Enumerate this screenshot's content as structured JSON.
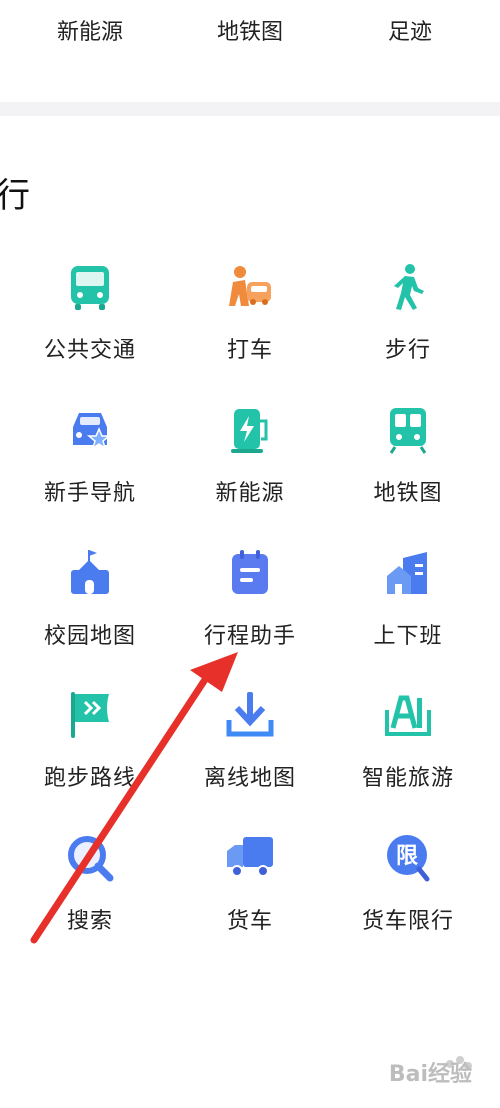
{
  "top_row": [
    "新能源",
    "地铁图",
    "足迹"
  ],
  "section_title": "行",
  "grid": [
    {
      "label": "公共交通",
      "icon": "bus-icon"
    },
    {
      "label": "打车",
      "icon": "taxi-icon"
    },
    {
      "label": "步行",
      "icon": "walk-icon"
    },
    {
      "label": "新手导航",
      "icon": "novice-car-icon"
    },
    {
      "label": "新能源",
      "icon": "charging-station-icon"
    },
    {
      "label": "地铁图",
      "icon": "subway-icon"
    },
    {
      "label": "校园地图",
      "icon": "campus-icon"
    },
    {
      "label": "行程助手",
      "icon": "calendar-icon"
    },
    {
      "label": "上下班",
      "icon": "commute-building-icon"
    },
    {
      "label": "跑步路线",
      "icon": "flag-icon"
    },
    {
      "label": "离线地图",
      "icon": "download-icon"
    },
    {
      "label": "智能旅游",
      "icon": "ai-tour-icon"
    },
    {
      "label": "搜索",
      "icon": "search-icon"
    },
    {
      "label": "货车",
      "icon": "truck-icon"
    },
    {
      "label": "货车限行",
      "icon": "truck-restriction-icon"
    }
  ],
  "watermark": {
    "text": "Bai经验"
  },
  "colors": {
    "teal": "#22c3a8",
    "orange": "#f08a3c",
    "blue": "#4a7cf0",
    "red_arrow": "#e8302a"
  }
}
